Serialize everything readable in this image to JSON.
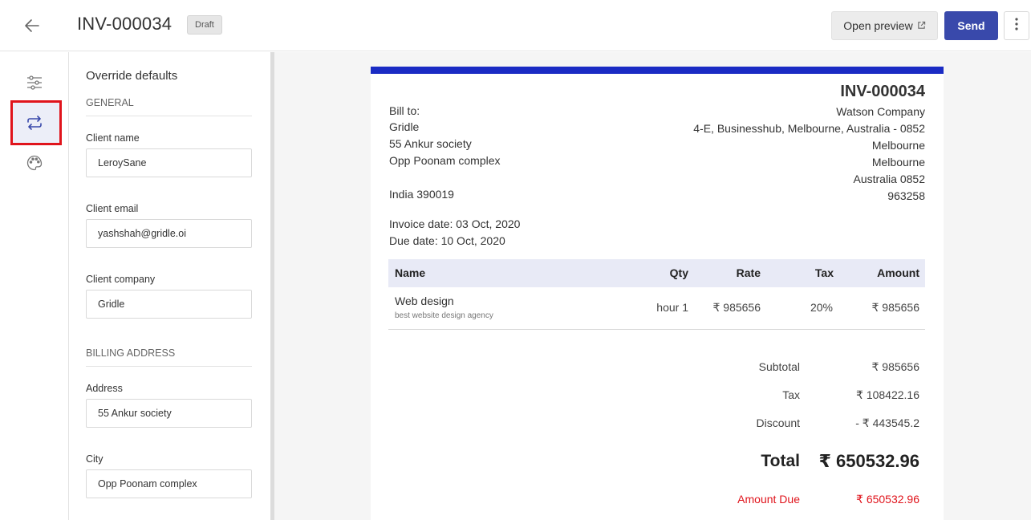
{
  "header": {
    "title": "INV-000034",
    "status_badge": "Draft",
    "open_preview_label": "Open preview",
    "send_label": "Send"
  },
  "rail": {
    "items": [
      {
        "icon": "sliders-icon"
      },
      {
        "icon": "swap-arrows-icon",
        "active": true
      },
      {
        "icon": "palette-icon"
      }
    ],
    "active_color": "#3949ab",
    "highlight_color": "#e0141c"
  },
  "form": {
    "title": "Override defaults",
    "general_heading": "GENERAL",
    "client_name_label": "Client name",
    "client_name_value": "LeroySane",
    "client_email_label": "Client email",
    "client_email_value": "yashshah@gridle.oi",
    "client_company_label": "Client company",
    "client_company_value": "Gridle",
    "billing_heading": "BILLING ADDRESS",
    "address_label": "Address",
    "address_value": "55 Ankur society",
    "city_label": "City",
    "city_value": "Opp Poonam complex"
  },
  "invoice": {
    "number": "INV-000034",
    "accent_color": "#1a2bc4",
    "bill_to_label": "Bill to:",
    "bill_to": {
      "company": "Gridle",
      "line1": "55 Ankur society",
      "line2": "Opp Poonam complex",
      "line3": "India 390019"
    },
    "from": {
      "company": "Watson Company",
      "address": "4-E, Businesshub, Melbourne, Australia - 0852",
      "city": "Melbourne",
      "state": "Melbourne",
      "country_zip": "Australia 0852",
      "phone": "963258"
    },
    "invoice_date": "Invoice date: 03 Oct, 2020",
    "due_date": "Due date: 10 Oct, 2020",
    "table": {
      "headers": {
        "name": "Name",
        "qty": "Qty",
        "rate": "Rate",
        "tax": "Tax",
        "amount": "Amount"
      },
      "rows": [
        {
          "name": "Web design",
          "description": "best website design agency",
          "qty": "hour 1",
          "rate": "₹ 985656",
          "tax": "20%",
          "amount": "₹ 985656"
        }
      ]
    },
    "totals": {
      "subtotal_label": "Subtotal",
      "subtotal_value": "₹ 985656",
      "tax_label": "Tax",
      "tax_value": "₹ 108422.16",
      "discount_label": "Discount",
      "discount_value": "- ₹ 443545.2",
      "total_label": "Total",
      "total_value": "₹ 650532.96",
      "amount_due_label": "Amount Due",
      "amount_due_value": "₹ 650532.96"
    }
  }
}
